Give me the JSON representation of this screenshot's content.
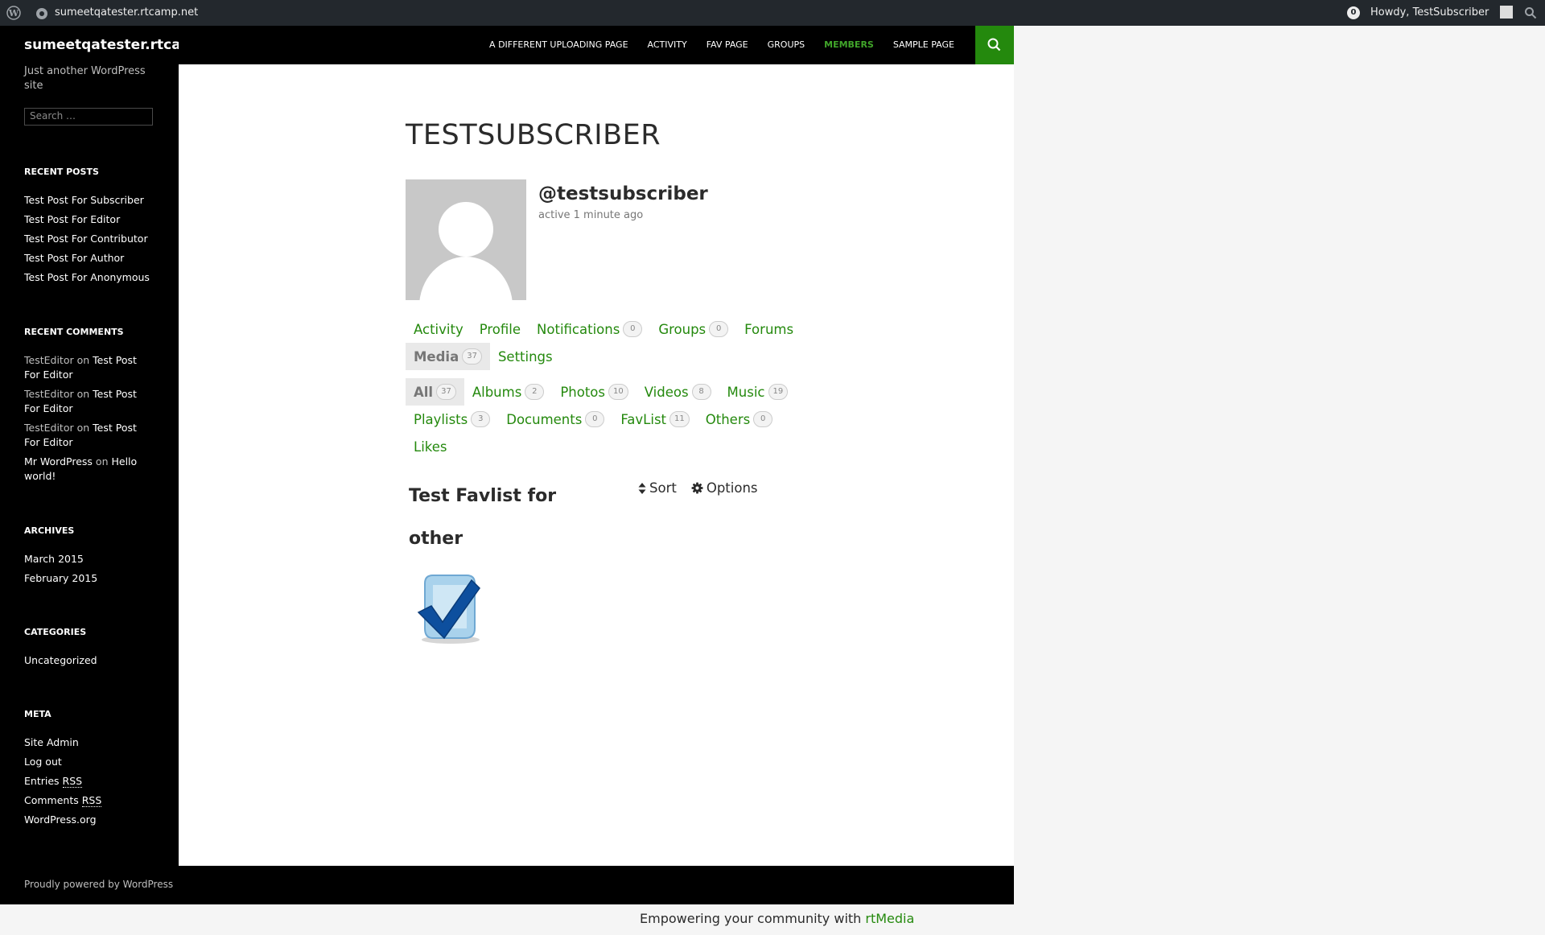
{
  "admin_bar": {
    "site_name": "sumeetqatester.rtcamp.net",
    "notification_count": "0",
    "howdy": "Howdy, TestSubscriber"
  },
  "site": {
    "title": "sumeetqatester.rtcamp.net",
    "tagline": "Just another WordPress site",
    "search_placeholder": "Search …"
  },
  "menu": {
    "items": [
      {
        "label": "A DIFFERENT UPLOADING PAGE"
      },
      {
        "label": "ACTIVITY"
      },
      {
        "label": "FAV PAGE"
      },
      {
        "label": "GROUPS"
      },
      {
        "label": "MEMBERS"
      },
      {
        "label": "SAMPLE PAGE"
      }
    ],
    "current": "MEMBERS"
  },
  "widgets": {
    "recent_posts": {
      "title": "RECENT POSTS",
      "items": [
        "Test Post For Subscriber",
        "Test Post For Editor",
        "Test Post For Contributor",
        "Test Post For Author",
        "Test Post For Anonymous"
      ]
    },
    "recent_comments": {
      "title": "RECENT COMMENTS",
      "on_word": "on",
      "items": [
        {
          "author": "TestEditor",
          "post": "Test Post For Editor"
        },
        {
          "author": "TestEditor",
          "post": "Test Post For Editor"
        },
        {
          "author": "TestEditor",
          "post": "Test Post For Editor"
        },
        {
          "author": "Mr WordPress",
          "post": "Hello world!"
        }
      ]
    },
    "archives": {
      "title": "ARCHIVES",
      "items": [
        "March 2015",
        "February 2015"
      ]
    },
    "categories": {
      "title": "CATEGORIES",
      "items": [
        "Uncategorized"
      ]
    },
    "meta": {
      "title": "META",
      "site_admin": "Site Admin",
      "log_out": "Log out",
      "entries_prefix": "Entries",
      "comments_prefix": "Comments",
      "rss": "RSS",
      "wordpress_org": "WordPress.org"
    }
  },
  "profile": {
    "name": "TESTSUBSCRIBER",
    "mention": "@testsubscriber",
    "last_active": "active 1 minute ago"
  },
  "profile_nav": {
    "activity": "Activity",
    "profile": "Profile",
    "notifications": "Notifications",
    "notifications_count": "0",
    "groups": "Groups",
    "groups_count": "0",
    "forums": "Forums",
    "media": "Media",
    "media_count": "37",
    "settings": "Settings"
  },
  "media_nav": {
    "all": "All",
    "all_count": "37",
    "albums": "Albums",
    "albums_count": "2",
    "photos": "Photos",
    "photos_count": "10",
    "videos": "Videos",
    "videos_count": "8",
    "music": "Music",
    "music_count": "19",
    "playlists": "Playlists",
    "playlists_count": "3",
    "documents": "Documents",
    "documents_count": "0",
    "favlist": "FavList",
    "favlist_count": "11",
    "others": "Others",
    "others_count": "0",
    "likes": "Likes"
  },
  "gallery": {
    "title": "Test Favlist for other",
    "sort_label": "Sort",
    "options_label": "Options",
    "thumbnail_icon": "checkmark-icon"
  },
  "footer": {
    "powered": "Proudly powered by WordPress",
    "rtmedia_prefix": "Empowering your community with",
    "rtmedia_brand": "rtMedia"
  },
  "colors": {
    "accent_green": "#24890d",
    "current_menu": "#41a62a",
    "dark": "#000000",
    "admin_bar": "#23282d"
  }
}
